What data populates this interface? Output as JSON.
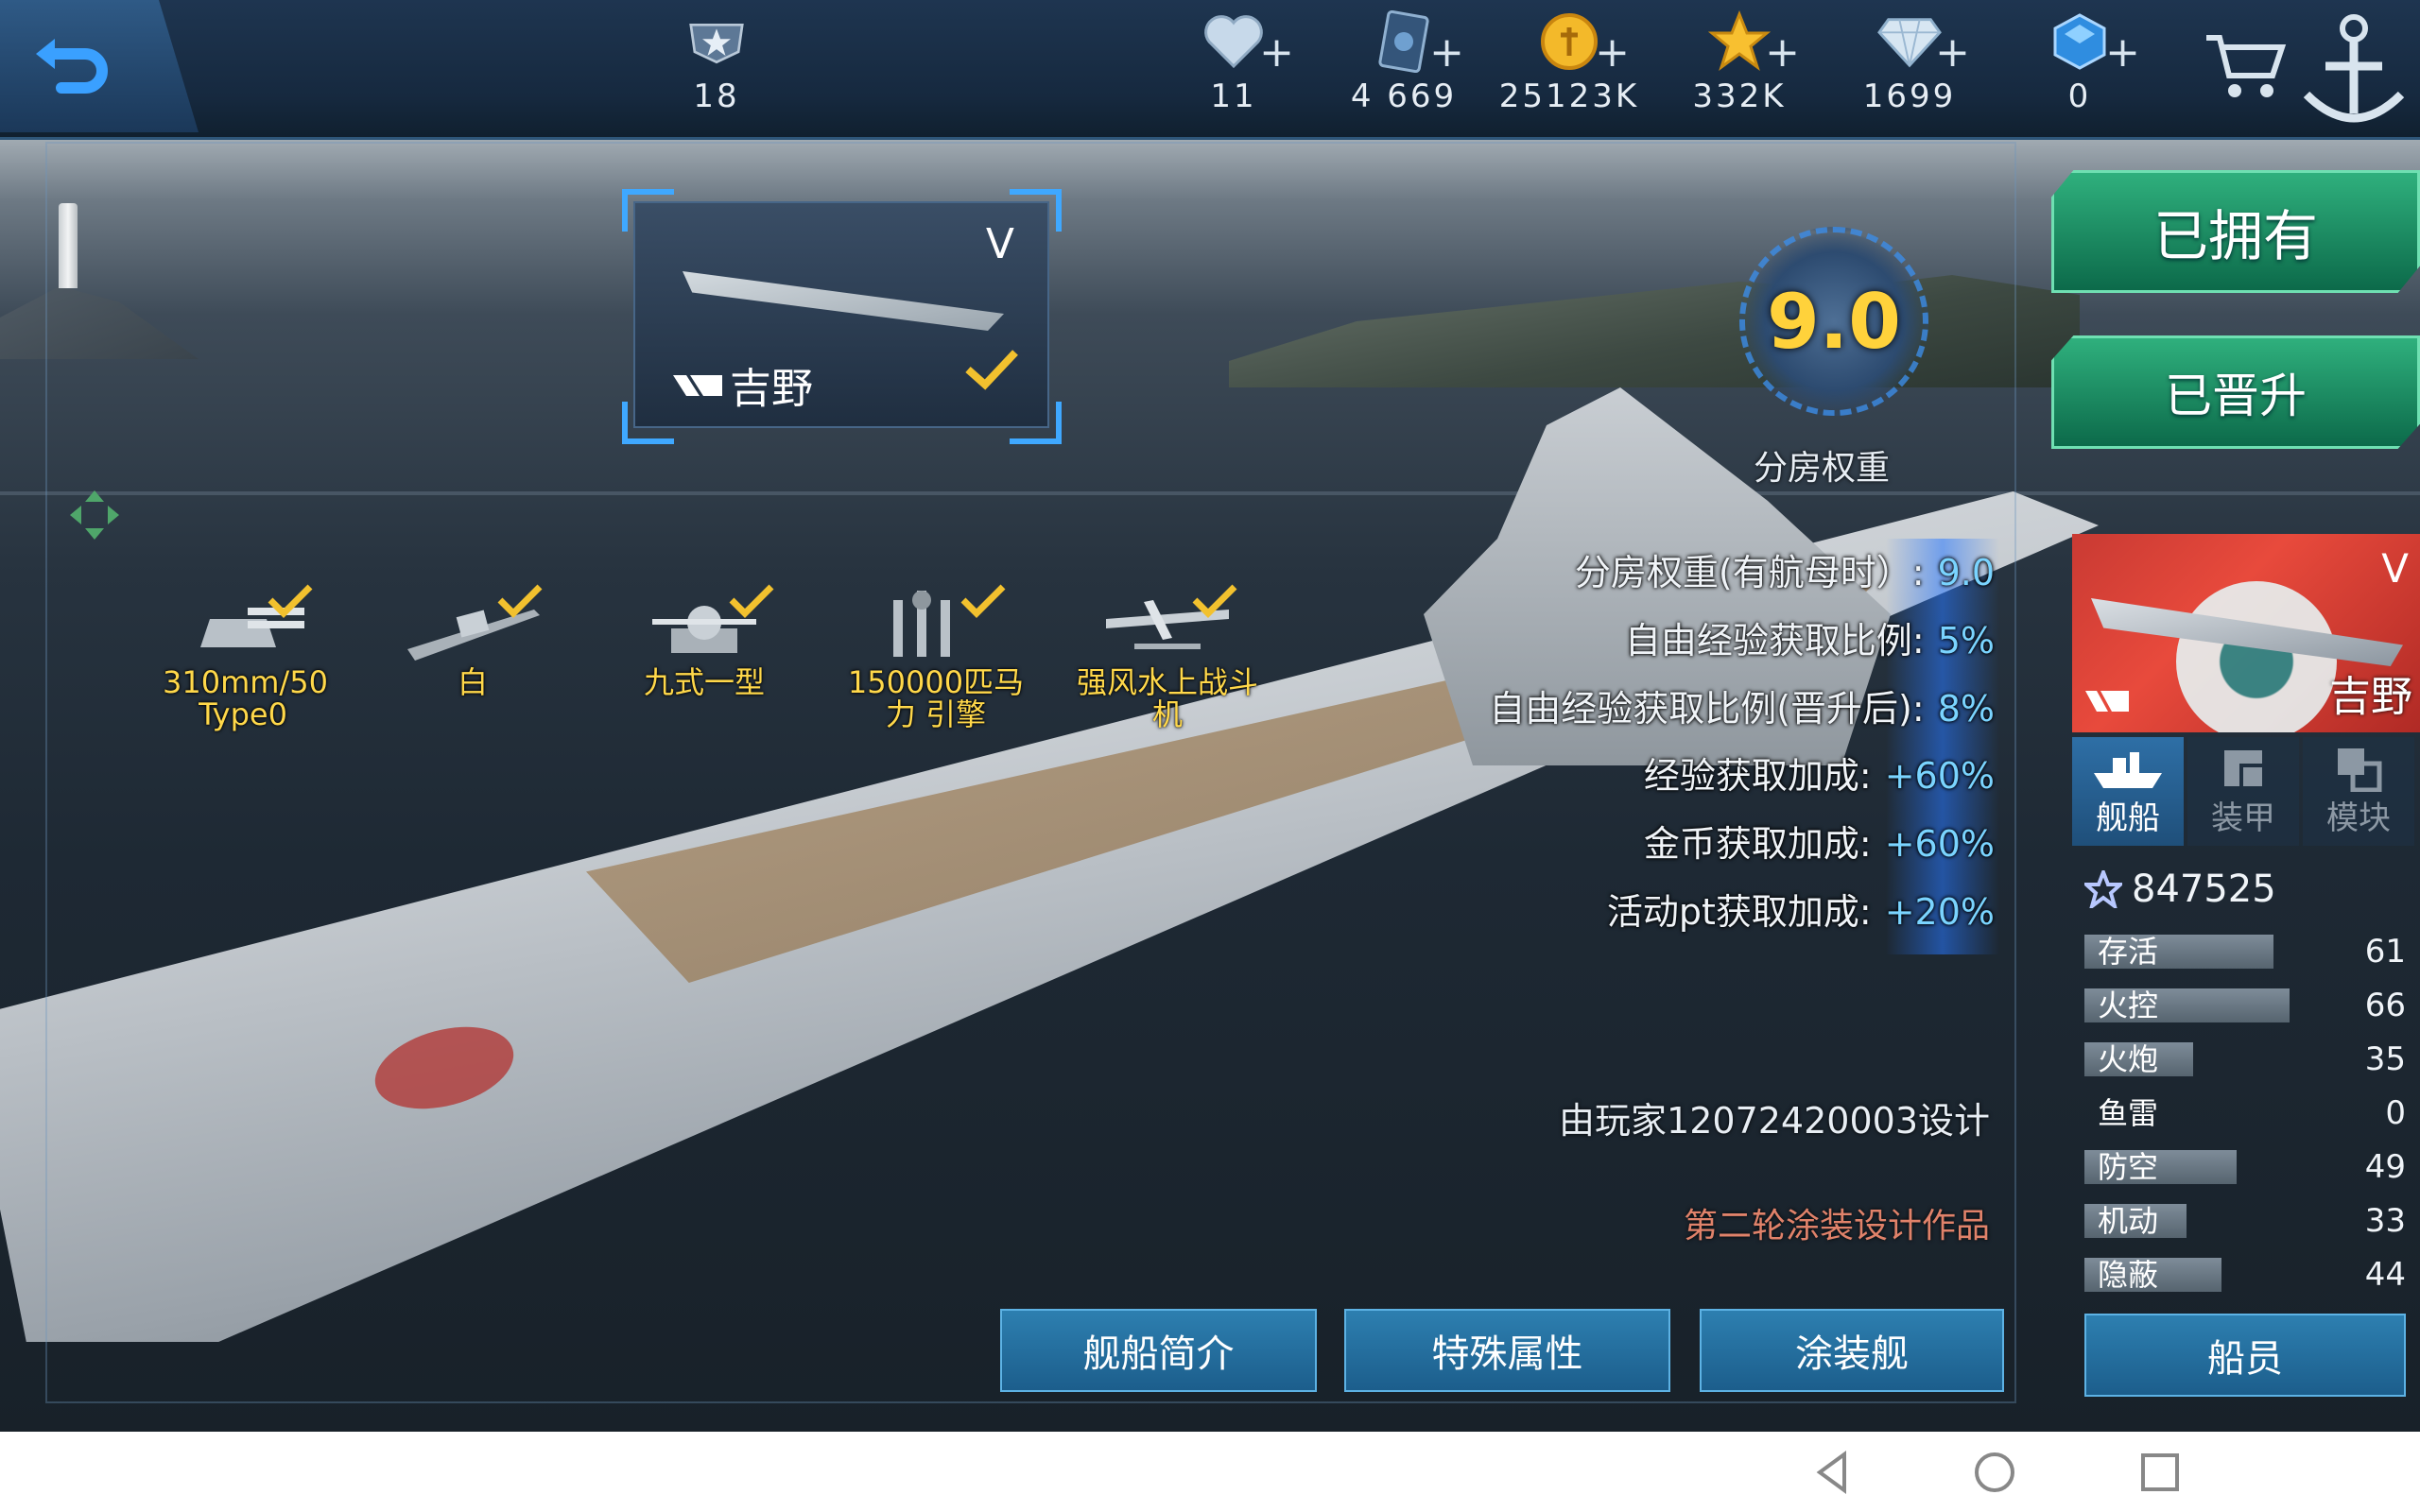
{
  "topbar": {
    "rank_value": "18",
    "resources": [
      {
        "icon": "heart-icon",
        "value": "11"
      },
      {
        "icon": "card-icon",
        "value": "4 669"
      },
      {
        "icon": "gold-coin-icon",
        "value": "25123K"
      },
      {
        "icon": "star-icon",
        "value": "332K"
      },
      {
        "icon": "diamond-icon",
        "value": "1699"
      },
      {
        "icon": "blue-gem-icon",
        "value": "0"
      }
    ]
  },
  "ship_card": {
    "tier": "V",
    "name": "吉野"
  },
  "rating": {
    "value": "9.0",
    "label": "分房权重"
  },
  "equipment": [
    {
      "name": "310mm/50 Type0"
    },
    {
      "name": "白"
    },
    {
      "name": "九式一型"
    },
    {
      "name": "150000匹马力 引擎"
    },
    {
      "name": "强风水上战斗机"
    }
  ],
  "stats": [
    {
      "label": "分房权重(有航母时）:",
      "value": "9.0"
    },
    {
      "label": "自由经验获取比例:",
      "value": "5%"
    },
    {
      "label": "自由经验获取比例(晋升后):",
      "value": "8%"
    },
    {
      "label": "经验获取加成:",
      "value": "+60%"
    },
    {
      "label": "金币获取加成:",
      "value": "+60%"
    },
    {
      "label": "活动pt获取加成:",
      "value": "+20%"
    }
  ],
  "designer": "由玩家12072420003设计",
  "design_note": "第二轮涂装设计作品",
  "buttons": {
    "intro": "舰船简介",
    "special": "特殊属性",
    "skin": "涂装舰",
    "owned": "已拥有",
    "promoted": "已晋升",
    "crew": "船员"
  },
  "right_panel": {
    "tier": "V",
    "name": "吉野",
    "tabs": [
      {
        "label": "舰船",
        "icon": "ship-icon",
        "active": true
      },
      {
        "label": "装甲",
        "icon": "armor-icon",
        "active": false
      },
      {
        "label": "模块",
        "icon": "module-icon",
        "active": false
      }
    ],
    "score": "847525",
    "attributes": [
      {
        "name": "存活",
        "value": 61
      },
      {
        "name": "火控",
        "value": 66
      },
      {
        "name": "火炮",
        "value": 35
      },
      {
        "name": "鱼雷",
        "value": 0
      },
      {
        "name": "防空",
        "value": 49
      },
      {
        "name": "机动",
        "value": 33
      },
      {
        "name": "隐蔽",
        "value": 44
      }
    ]
  },
  "colors": {
    "accent_blue": "#3fa8ff",
    "owned_green": "#1e8f63",
    "rating_yellow": "#ffd23b",
    "equip_yellow": "#ffd84a",
    "note_orange": "#e0826a"
  }
}
